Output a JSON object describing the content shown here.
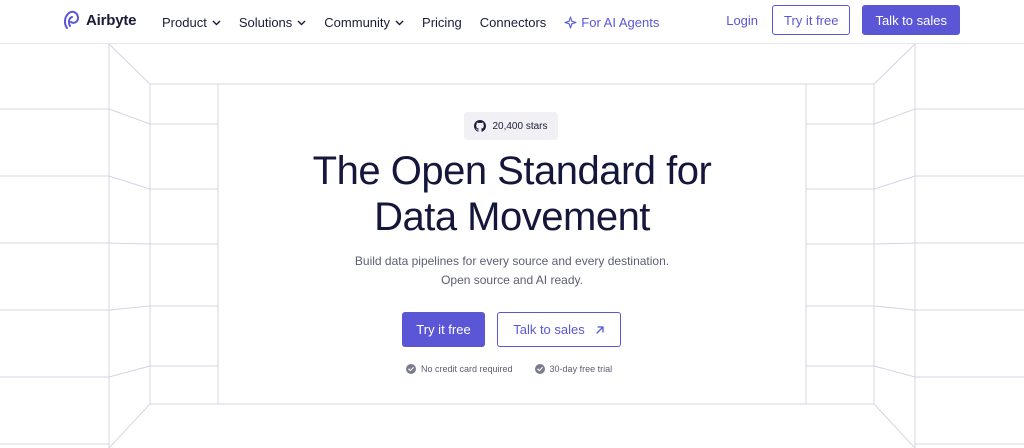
{
  "nav": {
    "brand": "Airbyte",
    "links": [
      {
        "label": "Product",
        "dropdown": true
      },
      {
        "label": "Solutions",
        "dropdown": true
      },
      {
        "label": "Community",
        "dropdown": true
      },
      {
        "label": "Pricing",
        "dropdown": false
      },
      {
        "label": "Connectors",
        "dropdown": false
      }
    ],
    "ai_link": "For AI Agents",
    "login": "Login",
    "try_free": "Try it free",
    "talk_sales": "Talk to sales"
  },
  "hero": {
    "stars": "20,400 stars",
    "headline_line1": "The Open Standard for",
    "headline_line2": "Data Movement",
    "sub_line1": "Build data pipelines for every source and every destination.",
    "sub_line2": "Open source and AI ready.",
    "cta_primary": "Try it free",
    "cta_secondary": "Talk to sales",
    "perk1": "No credit card required",
    "perk2": "30-day free trial"
  },
  "colors": {
    "accent": "#5b56d6",
    "heading": "#14163a",
    "muted": "#5c5e72",
    "grid_line": "#d4d4e4"
  },
  "icons": {
    "brand": "airbyte-logo-icon",
    "chevron": "chevron-down-icon",
    "ai": "sparkle-icon",
    "github": "github-icon",
    "arrow": "arrow-up-right-icon",
    "check": "check-circle-icon"
  }
}
